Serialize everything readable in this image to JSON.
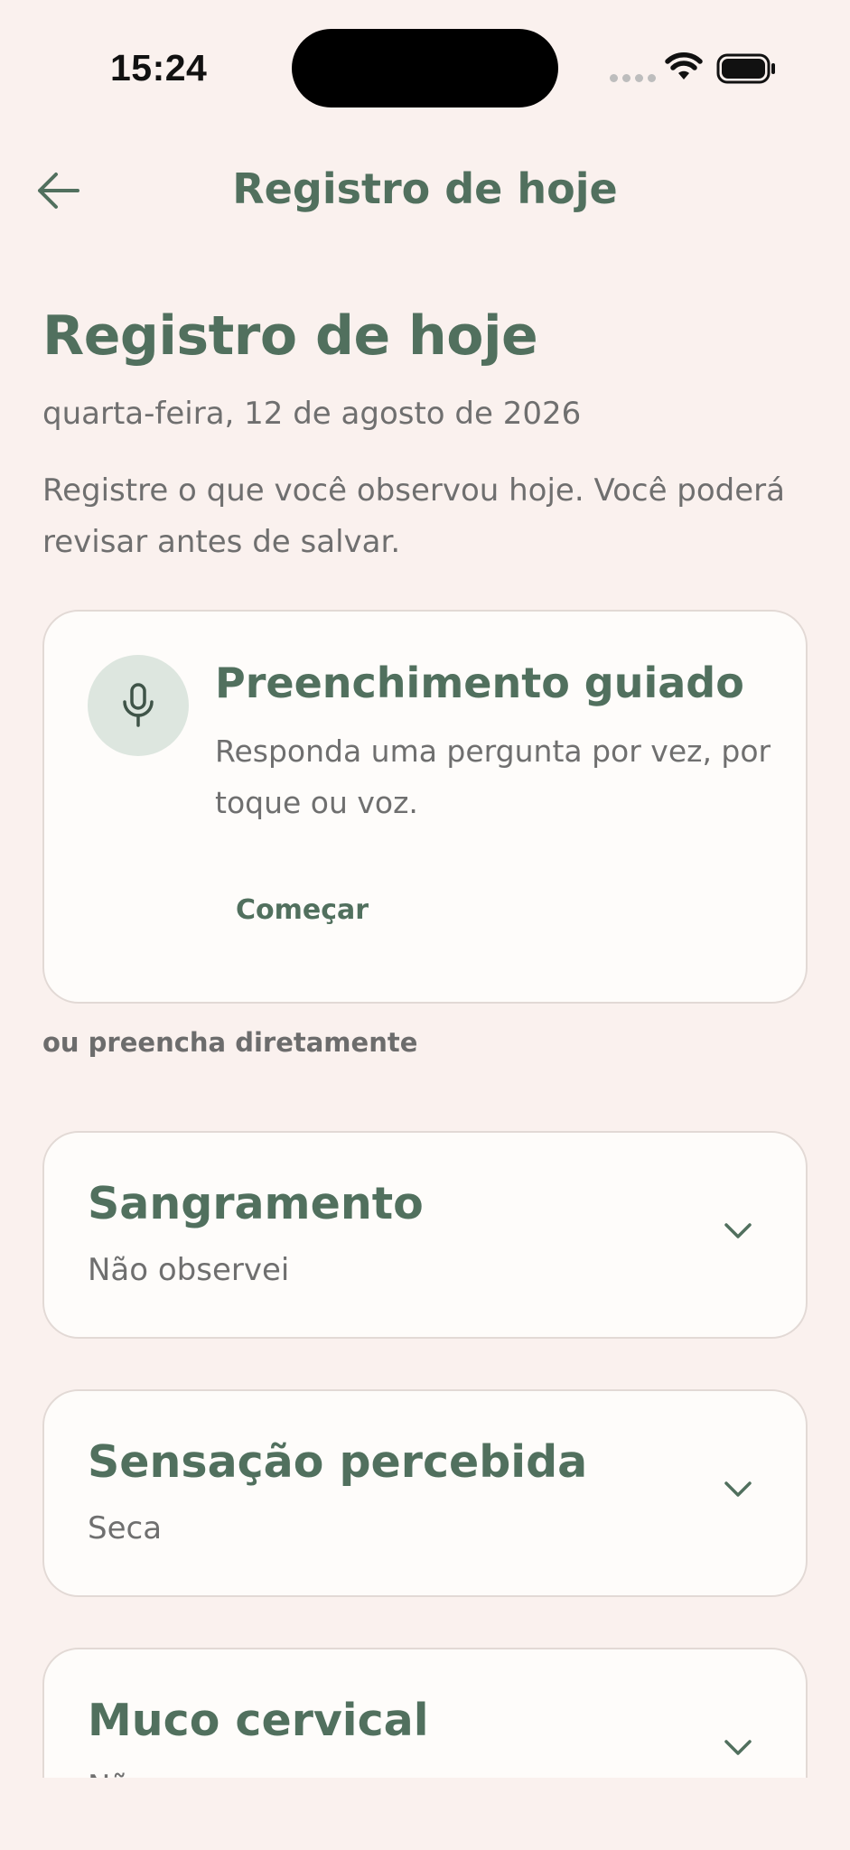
{
  "status_bar": {
    "time": "15:24",
    "icons": [
      "cellular-signal-icon",
      "wifi-icon",
      "battery-icon"
    ]
  },
  "nav": {
    "back_icon": "arrow-left-icon",
    "title": "Registro de hoje"
  },
  "header": {
    "title": "Registro de hoje",
    "date": "quarta-feira, 12 de agosto de 2026",
    "description": "Registre o que você observou hoje. Você poderá revisar antes de salvar."
  },
  "guided": {
    "icon": "microphone-icon",
    "title": "Preenchimento guiado",
    "description": "Responda uma pergunta por vez, por toque ou voz.",
    "button_label": "Começar"
  },
  "direct_label": "ou preencha diretamente",
  "fields": [
    {
      "title": "Sangramento",
      "value": "Não observei"
    },
    {
      "title": "Sensação percebida",
      "value": "Seca"
    },
    {
      "title": "Muco cervical",
      "value": "Não..."
    }
  ],
  "colors": {
    "background": "#faf1ee",
    "card": "#fefcfa",
    "accent": "#51705e",
    "mic_bg": "#dde6df",
    "muted_text": "#6f6f6f"
  }
}
